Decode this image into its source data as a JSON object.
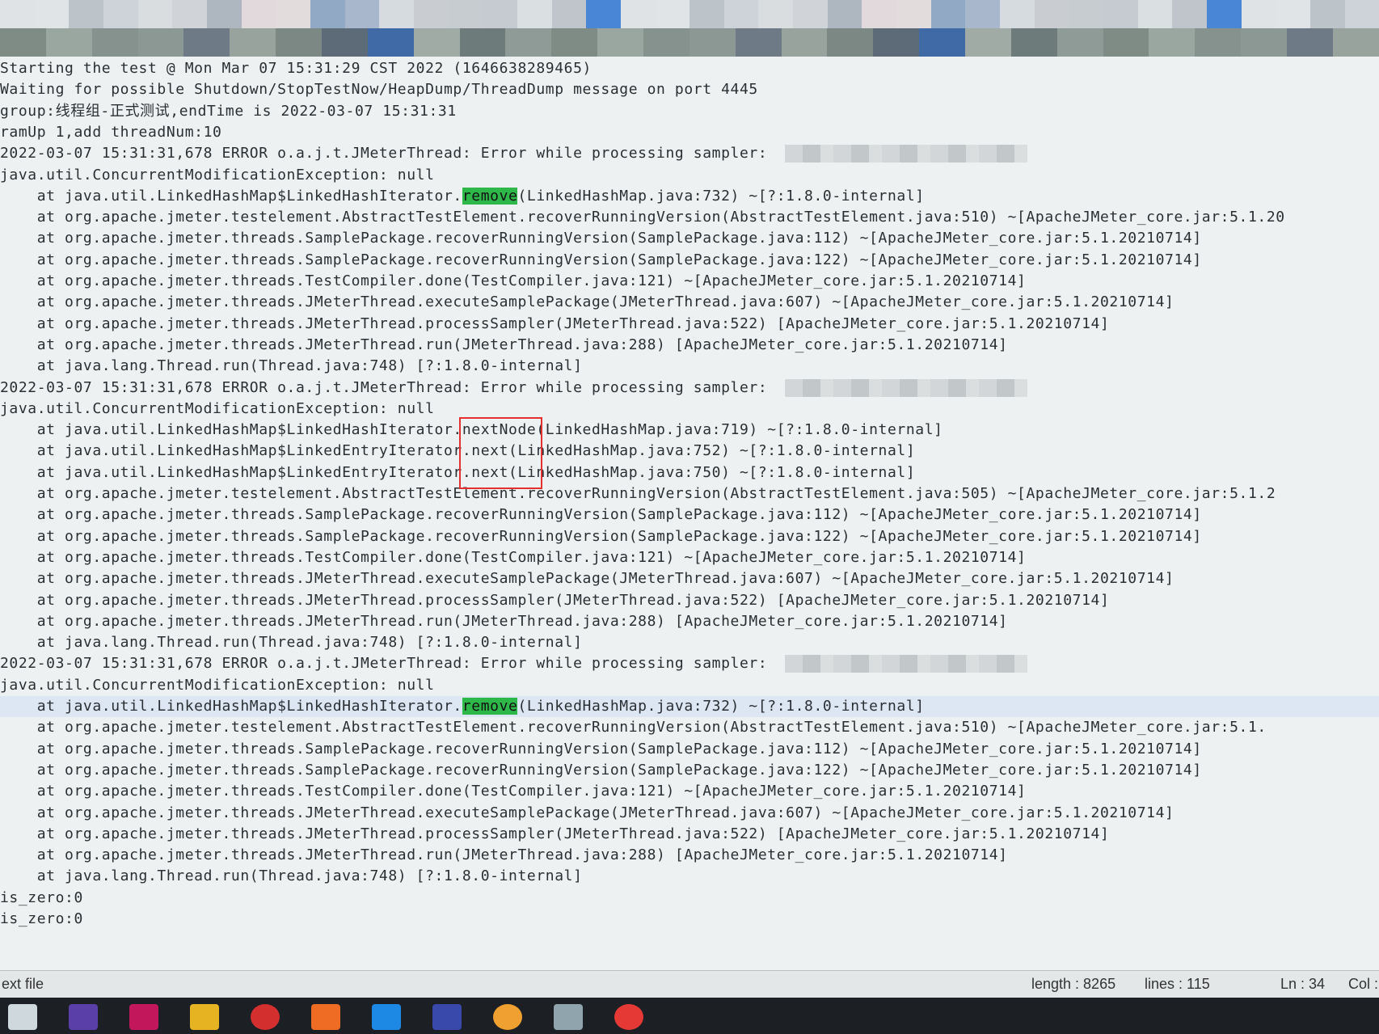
{
  "editor": {
    "lines": [
      {
        "text": "Starting the test @ Mon Mar 07 15:31:29 CST 2022 (1646638289465)"
      },
      {
        "text": "Waiting for possible Shutdown/StopTestNow/HeapDump/ThreadDump message on port 4445"
      },
      {
        "text": "group:线程组-正式测试,endTime is 2022-03-07 15:31:31"
      },
      {
        "text": "ramUp 1,add threadNum:10"
      },
      {
        "text": "2022-03-07 15:31:31,678 ERROR o.a.j.t.JMeterThread: Error while processing sampler: "
      },
      {
        "text": "java.util.ConcurrentModificationException: null"
      },
      {
        "pre": "    at java.util.LinkedHashMap$LinkedHashIterator.",
        "hl": "remove",
        "post": "(LinkedHashMap.java:732) ~[?:1.8.0-internal]"
      },
      {
        "text": "    at org.apache.jmeter.testelement.AbstractTestElement.recoverRunningVersion(AbstractTestElement.java:510) ~[ApacheJMeter_core.jar:5.1.20"
      },
      {
        "text": "    at org.apache.jmeter.threads.SamplePackage.recoverRunningVersion(SamplePackage.java:112) ~[ApacheJMeter_core.jar:5.1.20210714]"
      },
      {
        "text": "    at org.apache.jmeter.threads.SamplePackage.recoverRunningVersion(SamplePackage.java:122) ~[ApacheJMeter_core.jar:5.1.20210714]"
      },
      {
        "text": "    at org.apache.jmeter.threads.TestCompiler.done(TestCompiler.java:121) ~[ApacheJMeter_core.jar:5.1.20210714]"
      },
      {
        "text": "    at org.apache.jmeter.threads.JMeterThread.executeSamplePackage(JMeterThread.java:607) ~[ApacheJMeter_core.jar:5.1.20210714]"
      },
      {
        "text": "    at org.apache.jmeter.threads.JMeterThread.processSampler(JMeterThread.java:522) [ApacheJMeter_core.jar:5.1.20210714]"
      },
      {
        "text": "    at org.apache.jmeter.threads.JMeterThread.run(JMeterThread.java:288) [ApacheJMeter_core.jar:5.1.20210714]"
      },
      {
        "text": "    at java.lang.Thread.run(Thread.java:748) [?:1.8.0-internal]"
      },
      {
        "text": "2022-03-07 15:31:31,678 ERROR o.a.j.t.JMeterThread: Error while processing sampler: "
      },
      {
        "text": "java.util.ConcurrentModificationException: null"
      },
      {
        "text": "    at java.util.LinkedHashMap$LinkedHashIterator.nextNode(LinkedHashMap.java:719) ~[?:1.8.0-internal]"
      },
      {
        "text": "    at java.util.LinkedHashMap$LinkedEntryIterator.next(LinkedHashMap.java:752) ~[?:1.8.0-internal]"
      },
      {
        "text": "    at java.util.LinkedHashMap$LinkedEntryIterator.next(LinkedHashMap.java:750) ~[?:1.8.0-internal]"
      },
      {
        "text": "    at org.apache.jmeter.testelement.AbstractTestElement.recoverRunningVersion(AbstractTestElement.java:505) ~[ApacheJMeter_core.jar:5.1.2"
      },
      {
        "text": "    at org.apache.jmeter.threads.SamplePackage.recoverRunningVersion(SamplePackage.java:112) ~[ApacheJMeter_core.jar:5.1.20210714]"
      },
      {
        "text": "    at org.apache.jmeter.threads.SamplePackage.recoverRunningVersion(SamplePackage.java:122) ~[ApacheJMeter_core.jar:5.1.20210714]"
      },
      {
        "text": "    at org.apache.jmeter.threads.TestCompiler.done(TestCompiler.java:121) ~[ApacheJMeter_core.jar:5.1.20210714]"
      },
      {
        "text": "    at org.apache.jmeter.threads.JMeterThread.executeSamplePackage(JMeterThread.java:607) ~[ApacheJMeter_core.jar:5.1.20210714]"
      },
      {
        "text": "    at org.apache.jmeter.threads.JMeterThread.processSampler(JMeterThread.java:522) [ApacheJMeter_core.jar:5.1.20210714]"
      },
      {
        "text": "    at org.apache.jmeter.threads.JMeterThread.run(JMeterThread.java:288) [ApacheJMeter_core.jar:5.1.20210714]"
      },
      {
        "text": "    at java.lang.Thread.run(Thread.java:748) [?:1.8.0-internal]"
      },
      {
        "text": "2022-03-07 15:31:31,678 ERROR o.a.j.t.JMeterThread: Error while processing sampler: "
      },
      {
        "text": "java.util.ConcurrentModificationException: null"
      },
      {
        "pre": "    at java.util.LinkedHashMap$LinkedHashIterator.",
        "hl": "remove",
        "post": "(LinkedHashMap.java:732) ~[?:1.8.0-internal]",
        "current": true
      },
      {
        "text": "    at org.apache.jmeter.testelement.AbstractTestElement.recoverRunningVersion(AbstractTestElement.java:510) ~[ApacheJMeter_core.jar:5.1."
      },
      {
        "text": "    at org.apache.jmeter.threads.SamplePackage.recoverRunningVersion(SamplePackage.java:112) ~[ApacheJMeter_core.jar:5.1.20210714]"
      },
      {
        "text": "    at org.apache.jmeter.threads.SamplePackage.recoverRunningVersion(SamplePackage.java:122) ~[ApacheJMeter_core.jar:5.1.20210714]"
      },
      {
        "text": "    at org.apache.jmeter.threads.TestCompiler.done(TestCompiler.java:121) ~[ApacheJMeter_core.jar:5.1.20210714]"
      },
      {
        "text": "    at org.apache.jmeter.threads.JMeterThread.executeSamplePackage(JMeterThread.java:607) ~[ApacheJMeter_core.jar:5.1.20210714]"
      },
      {
        "text": "    at org.apache.jmeter.threads.JMeterThread.processSampler(JMeterThread.java:522) [ApacheJMeter_core.jar:5.1.20210714]"
      },
      {
        "text": "    at org.apache.jmeter.threads.JMeterThread.run(JMeterThread.java:288) [ApacheJMeter_core.jar:5.1.20210714]"
      },
      {
        "text": "    at java.lang.Thread.run(Thread.java:748) [?:1.8.0-internal]"
      },
      {
        "text": "is_zero:0"
      },
      {
        "text": "is_zero:0"
      }
    ]
  },
  "status": {
    "file_type": "ext file",
    "length": "length : 8265",
    "lines": "lines : 115",
    "ln": "Ln : 34",
    "col": "Col :"
  },
  "colors": {
    "highlight": "#2fb84a",
    "annotation_box": "#e53030"
  },
  "taskbar_icons": [
    "notepad-icon",
    "intellij-icon",
    "app-icon",
    "folder-icon",
    "wps-icon",
    "postman-icon",
    "remote-desktop-icon",
    "network-icon",
    "chrome-dino-icon",
    "shell-icon",
    "chrome-icon"
  ]
}
